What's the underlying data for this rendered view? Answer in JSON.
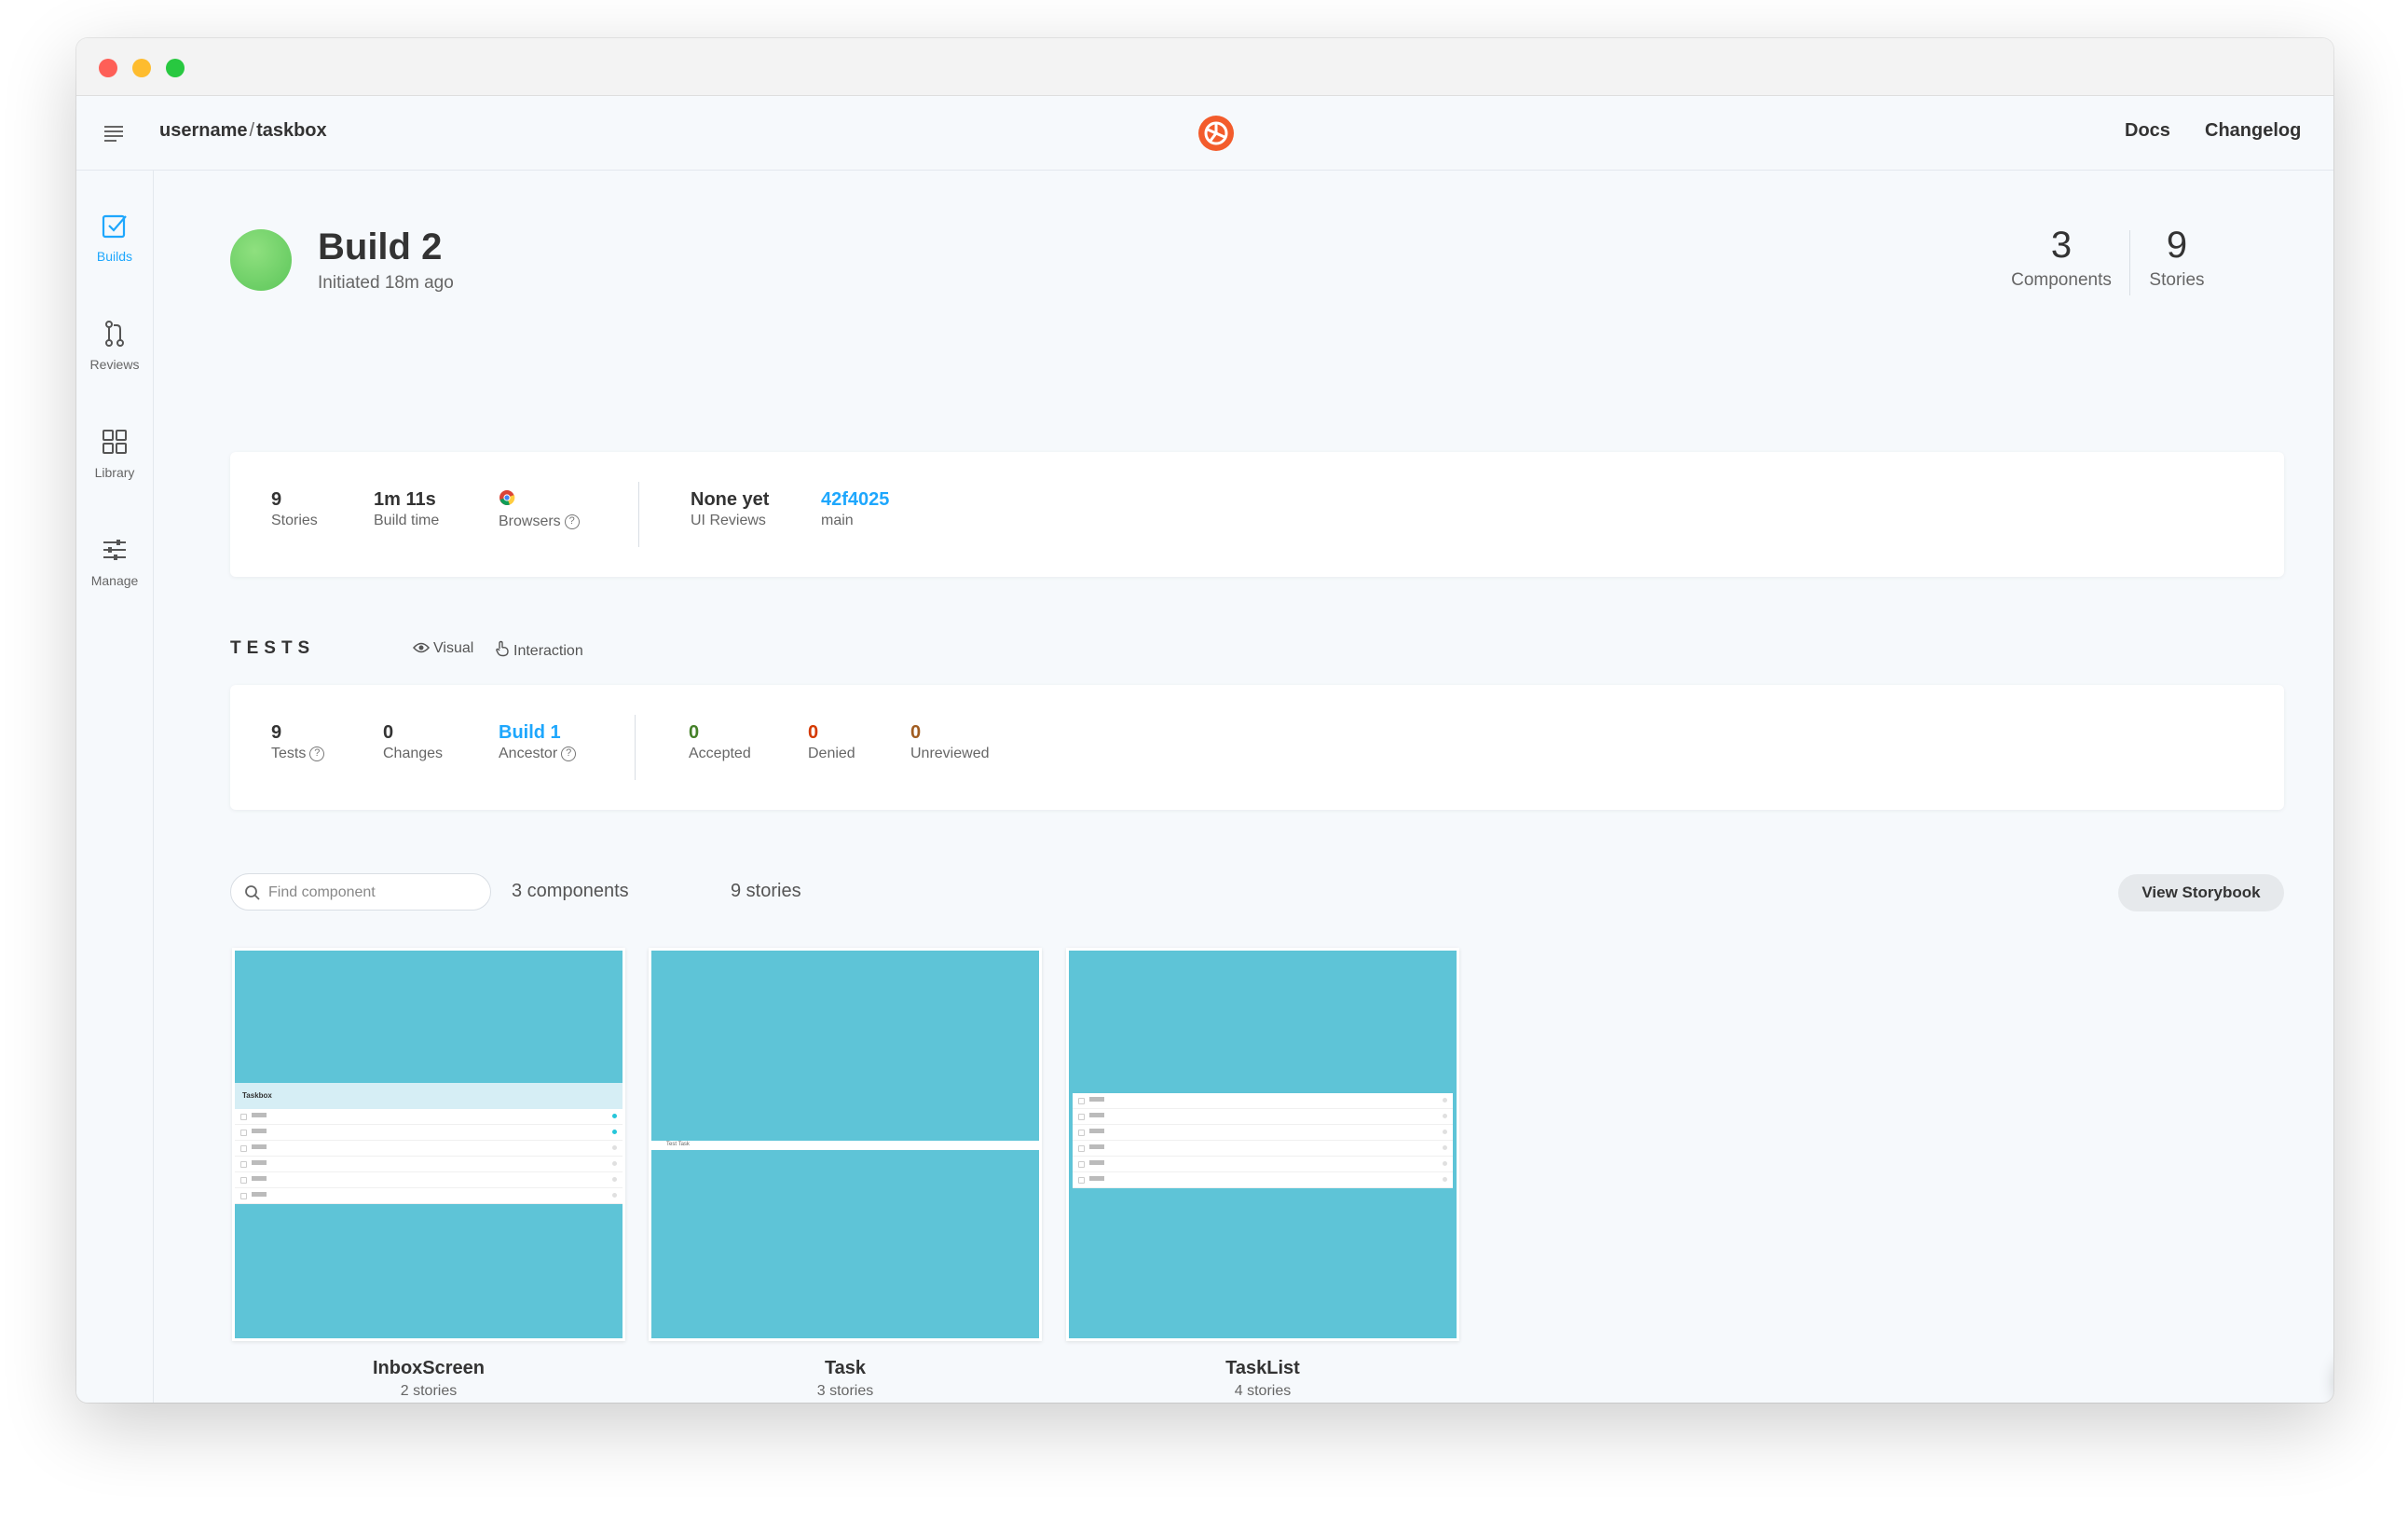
{
  "nav": {
    "repo_owner": "username",
    "repo_separator": "/",
    "repo_name": "taskbox",
    "docs_label": "Docs",
    "changelog_label": "Changelog"
  },
  "sidebar": {
    "items": [
      {
        "label": "Builds",
        "icon": "checkbox-icon",
        "active": true
      },
      {
        "label": "Reviews",
        "icon": "pull-request-icon",
        "active": false
      },
      {
        "label": "Library",
        "icon": "grid-icon",
        "active": false
      },
      {
        "label": "Manage",
        "icon": "sliders-icon",
        "active": false
      }
    ]
  },
  "build": {
    "title": "Build 2",
    "subtitle": "Initiated 18m ago",
    "status_color": "#66bf3c",
    "components_count": "3",
    "components_label": "Components",
    "stories_count": "9",
    "stories_label": "Stories"
  },
  "details": {
    "stories_value": "9",
    "stories_label": "Stories",
    "build_time_value": "1m 11s",
    "build_time_label": "Build time",
    "browsers_label": "Browsers",
    "browser_icon": "chrome-icon",
    "ui_reviews_value": "None yet",
    "ui_reviews_label": "UI Reviews",
    "commit_value": "42f4025",
    "branch_label": "main"
  },
  "tests": {
    "heading": "TESTS",
    "visual_label": "Visual",
    "interaction_label": "Interaction",
    "tests_value": "9",
    "tests_label": "Tests",
    "changes_value": "0",
    "changes_label": "Changes",
    "ancestor_value": "Build 1",
    "ancestor_label": "Ancestor",
    "accepted_value": "0",
    "accepted_label": "Accepted",
    "denied_value": "0",
    "denied_label": "Denied",
    "unreviewed_value": "0",
    "unreviewed_label": "Unreviewed"
  },
  "library": {
    "search_placeholder": "Find component",
    "components_count_text": "3 components",
    "stories_count_text": "9 stories",
    "view_storybook_label": "View Storybook",
    "components": [
      {
        "name": "InboxScreen",
        "stories": "2 stories"
      },
      {
        "name": "Task",
        "stories": "3 stories"
      },
      {
        "name": "TaskList",
        "stories": "4 stories"
      }
    ],
    "preview_bg": "#5ec4d7",
    "inbox_header": "Taskbox",
    "task_text": "Test Task",
    "task_items": [
      "Task 1",
      "Task 2",
      "Task 3",
      "Task 4",
      "Task 5",
      "Task 6"
    ]
  },
  "colors": {
    "accent": "#1ea7fd",
    "logo": "#f35c2c",
    "accepted": "#448028",
    "denied": "#d43900",
    "unreviewed": "#a15c20"
  }
}
